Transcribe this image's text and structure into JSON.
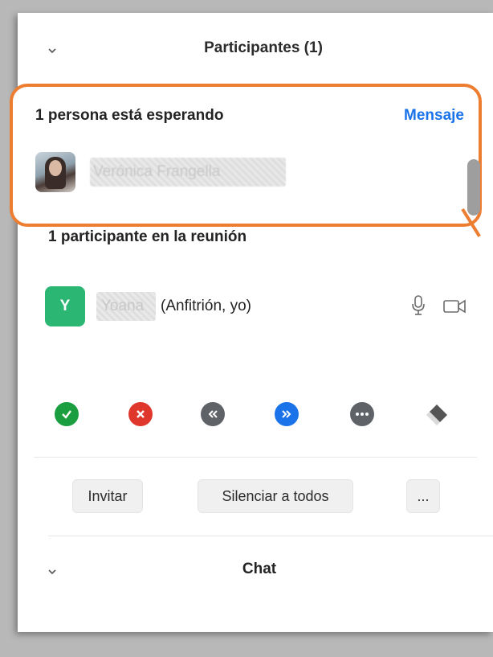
{
  "header": {
    "title": "Participantes (1)"
  },
  "waiting_room": {
    "title": "1 persona está esperando",
    "message_link": "Mensaje",
    "person_name": "Verónica Frangella"
  },
  "in_meeting": {
    "title": "1 participante en la reunión",
    "participant": {
      "initial": "Y",
      "name": "Yoana",
      "role": "(Anfitrión, yo)",
      "avatar_color": "#2bb673"
    }
  },
  "action_icons": [
    {
      "name": "check-icon",
      "color": "#1a9e3f"
    },
    {
      "name": "close-icon",
      "color": "#e0372c"
    },
    {
      "name": "rewind-icon",
      "color": "#5f6368"
    },
    {
      "name": "fast-forward-icon",
      "color": "#1a73e8"
    },
    {
      "name": "more-icon",
      "color": "#5f6368"
    },
    {
      "name": "eraser-icon",
      "color": "#555555"
    }
  ],
  "buttons": {
    "invite": "Invitar",
    "mute_all": "Silenciar a todos",
    "more": "..."
  },
  "chat": {
    "title": "Chat"
  },
  "colors": {
    "accent": "#1a73e8",
    "highlight": "#ed7d31"
  }
}
